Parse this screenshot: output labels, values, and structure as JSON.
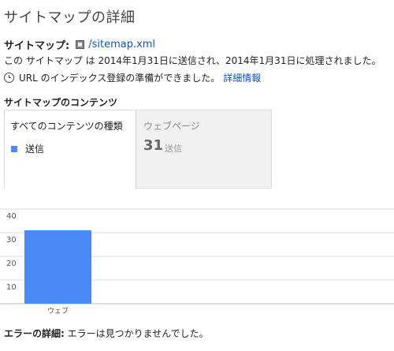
{
  "page": {
    "title": "サイトマップの詳細"
  },
  "sitemap": {
    "label": "サイトマップ:",
    "link": "/sitemap.xml"
  },
  "submission": {
    "text": "この サイトマップ は 2014年1月31日に送信され、2014年1月31日に処理されました。"
  },
  "status": {
    "message": "URL のインデックス登録の準備ができました。",
    "details_link": "詳細情報"
  },
  "contents": {
    "section_title": "サイトマップのコンテンツ",
    "tabs": [
      {
        "label": "すべてのコンテンツの種類",
        "legend_label": "送信",
        "legend_color": "#4a8af4"
      },
      {
        "label": "ウェブページ",
        "count": "31",
        "count_unit": "送信"
      }
    ]
  },
  "chart_data": {
    "type": "bar",
    "categories": [
      "ウェブ"
    ],
    "series": [
      {
        "name": "送信",
        "values": [
          31
        ],
        "color": "#4a8af4"
      }
    ],
    "ylim": [
      0,
      40
    ],
    "yticks": [
      10,
      20,
      30,
      40
    ],
    "grid": true
  },
  "error": {
    "label": "エラーの詳細:",
    "message": "エラーは見つかりませんでした。"
  }
}
